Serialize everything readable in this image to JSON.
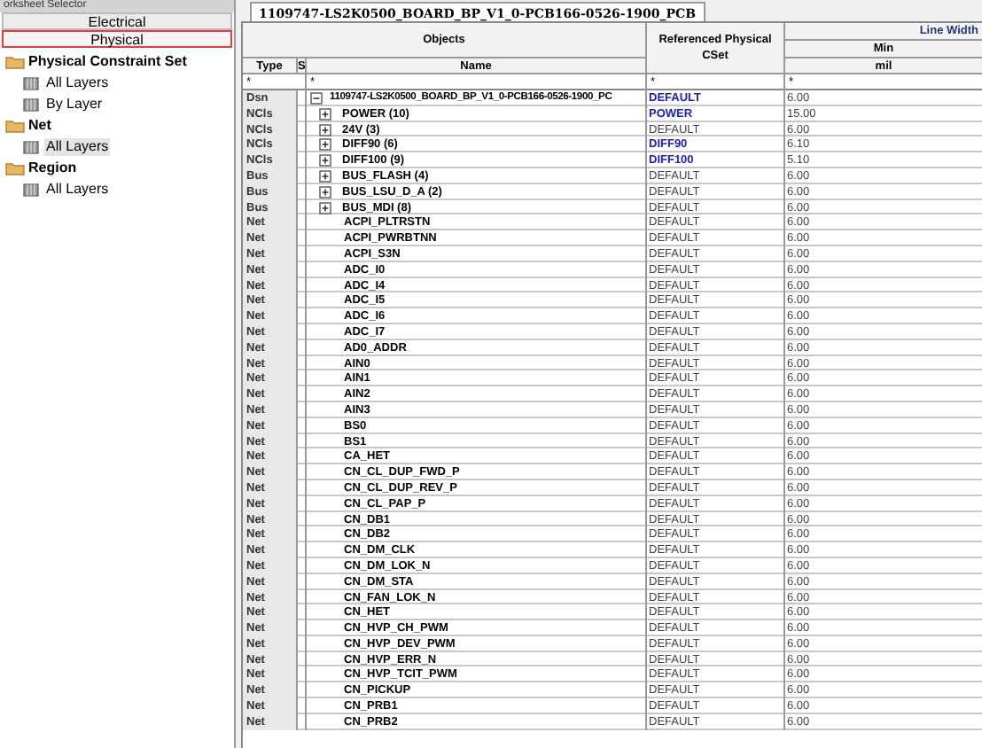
{
  "selector": {
    "title": "orksheet Selector",
    "buttons": [
      {
        "label": "Electrical",
        "selected": false
      },
      {
        "label": "Physical",
        "selected": true
      }
    ],
    "tree": [
      {
        "label": "Physical Constraint Set",
        "children": [
          {
            "label": "All Layers",
            "selected": false
          },
          {
            "label": "By Layer",
            "selected": false
          }
        ]
      },
      {
        "label": "Net",
        "children": [
          {
            "label": "All Layers",
            "selected": true
          }
        ]
      },
      {
        "label": "Region",
        "children": [
          {
            "label": "All Layers",
            "selected": false
          }
        ]
      }
    ]
  },
  "tab": {
    "label": "1109747-LS2K0500_BOARD_BP_V1_0-PCB166-0526-1900_PCB"
  },
  "table": {
    "group_header": "Objects",
    "columns": {
      "type": "Type",
      "s": "S",
      "name": "Name",
      "cset": "Referenced Physical CSet",
      "line_width": "Line Width",
      "min": "Min",
      "unit": "mil"
    },
    "filters": {
      "type": "*",
      "name": "*",
      "cset": "*",
      "min": "*"
    },
    "rows": [
      {
        "type": "Dsn",
        "expandable": true,
        "expanded": true,
        "name": "1109747-LS2K0500_BOARD_BP_V1_0-PCB166-0526-1900_PC",
        "cset": "DEFAULT",
        "linked": true,
        "min": "6.00"
      },
      {
        "type": "NCls",
        "expandable": true,
        "expanded": false,
        "name": "POWER (10)",
        "cset": "POWER",
        "linked": true,
        "min": "15.00"
      },
      {
        "type": "NCls",
        "expandable": true,
        "expanded": false,
        "name": "24V (3)",
        "cset": "DEFAULT",
        "linked": false,
        "min": "6.00"
      },
      {
        "type": "NCls",
        "expandable": true,
        "expanded": false,
        "name": "DIFF90 (6)",
        "cset": "DIFF90",
        "linked": true,
        "min": "6.10"
      },
      {
        "type": "NCls",
        "expandable": true,
        "expanded": false,
        "name": "DIFF100 (9)",
        "cset": "DIFF100",
        "linked": true,
        "min": "5.10"
      },
      {
        "type": "Bus",
        "expandable": true,
        "expanded": false,
        "name": "BUS_FLASH (4)",
        "cset": "DEFAULT",
        "linked": false,
        "min": "6.00"
      },
      {
        "type": "Bus",
        "expandable": true,
        "expanded": false,
        "name": "BUS_LSU_D_A (2)",
        "cset": "DEFAULT",
        "linked": false,
        "min": "6.00"
      },
      {
        "type": "Bus",
        "expandable": true,
        "expanded": false,
        "name": "BUS_MDI (8)",
        "cset": "DEFAULT",
        "linked": false,
        "min": "6.00"
      },
      {
        "type": "Net",
        "expandable": false,
        "expanded": false,
        "name": "ACPI_PLTRSTN",
        "cset": "DEFAULT",
        "linked": false,
        "min": "6.00"
      },
      {
        "type": "Net",
        "expandable": false,
        "expanded": false,
        "name": "ACPI_PWRBTNN",
        "cset": "DEFAULT",
        "linked": false,
        "min": "6.00"
      },
      {
        "type": "Net",
        "expandable": false,
        "expanded": false,
        "name": "ACPI_S3N",
        "cset": "DEFAULT",
        "linked": false,
        "min": "6.00"
      },
      {
        "type": "Net",
        "expandable": false,
        "expanded": false,
        "name": "ADC_I0",
        "cset": "DEFAULT",
        "linked": false,
        "min": "6.00"
      },
      {
        "type": "Net",
        "expandable": false,
        "expanded": false,
        "name": "ADC_I4",
        "cset": "DEFAULT",
        "linked": false,
        "min": "6.00"
      },
      {
        "type": "Net",
        "expandable": false,
        "expanded": false,
        "name": "ADC_I5",
        "cset": "DEFAULT",
        "linked": false,
        "min": "6.00"
      },
      {
        "type": "Net",
        "expandable": false,
        "expanded": false,
        "name": "ADC_I6",
        "cset": "DEFAULT",
        "linked": false,
        "min": "6.00"
      },
      {
        "type": "Net",
        "expandable": false,
        "expanded": false,
        "name": "ADC_I7",
        "cset": "DEFAULT",
        "linked": false,
        "min": "6.00"
      },
      {
        "type": "Net",
        "expandable": false,
        "expanded": false,
        "name": "AD0_ADDR",
        "cset": "DEFAULT",
        "linked": false,
        "min": "6.00"
      },
      {
        "type": "Net",
        "expandable": false,
        "expanded": false,
        "name": "AIN0",
        "cset": "DEFAULT",
        "linked": false,
        "min": "6.00"
      },
      {
        "type": "Net",
        "expandable": false,
        "expanded": false,
        "name": "AIN1",
        "cset": "DEFAULT",
        "linked": false,
        "min": "6.00"
      },
      {
        "type": "Net",
        "expandable": false,
        "expanded": false,
        "name": "AIN2",
        "cset": "DEFAULT",
        "linked": false,
        "min": "6.00"
      },
      {
        "type": "Net",
        "expandable": false,
        "expanded": false,
        "name": "AIN3",
        "cset": "DEFAULT",
        "linked": false,
        "min": "6.00"
      },
      {
        "type": "Net",
        "expandable": false,
        "expanded": false,
        "name": "BS0",
        "cset": "DEFAULT",
        "linked": false,
        "min": "6.00"
      },
      {
        "type": "Net",
        "expandable": false,
        "expanded": false,
        "name": "BS1",
        "cset": "DEFAULT",
        "linked": false,
        "min": "6.00"
      },
      {
        "type": "Net",
        "expandable": false,
        "expanded": false,
        "name": "CA_HET",
        "cset": "DEFAULT",
        "linked": false,
        "min": "6.00"
      },
      {
        "type": "Net",
        "expandable": false,
        "expanded": false,
        "name": "CN_CL_DUP_FWD_P",
        "cset": "DEFAULT",
        "linked": false,
        "min": "6.00"
      },
      {
        "type": "Net",
        "expandable": false,
        "expanded": false,
        "name": "CN_CL_DUP_REV_P",
        "cset": "DEFAULT",
        "linked": false,
        "min": "6.00"
      },
      {
        "type": "Net",
        "expandable": false,
        "expanded": false,
        "name": "CN_CL_PAP_P",
        "cset": "DEFAULT",
        "linked": false,
        "min": "6.00"
      },
      {
        "type": "Net",
        "expandable": false,
        "expanded": false,
        "name": "CN_DB1",
        "cset": "DEFAULT",
        "linked": false,
        "min": "6.00"
      },
      {
        "type": "Net",
        "expandable": false,
        "expanded": false,
        "name": "CN_DB2",
        "cset": "DEFAULT",
        "linked": false,
        "min": "6.00"
      },
      {
        "type": "Net",
        "expandable": false,
        "expanded": false,
        "name": "CN_DM_CLK",
        "cset": "DEFAULT",
        "linked": false,
        "min": "6.00"
      },
      {
        "type": "Net",
        "expandable": false,
        "expanded": false,
        "name": "CN_DM_LOK_N",
        "cset": "DEFAULT",
        "linked": false,
        "min": "6.00"
      },
      {
        "type": "Net",
        "expandable": false,
        "expanded": false,
        "name": "CN_DM_STA",
        "cset": "DEFAULT",
        "linked": false,
        "min": "6.00"
      },
      {
        "type": "Net",
        "expandable": false,
        "expanded": false,
        "name": "CN_FAN_LOK_N",
        "cset": "DEFAULT",
        "linked": false,
        "min": "6.00"
      },
      {
        "type": "Net",
        "expandable": false,
        "expanded": false,
        "name": "CN_HET",
        "cset": "DEFAULT",
        "linked": false,
        "min": "6.00"
      },
      {
        "type": "Net",
        "expandable": false,
        "expanded": false,
        "name": "CN_HVP_CH_PWM",
        "cset": "DEFAULT",
        "linked": false,
        "min": "6.00"
      },
      {
        "type": "Net",
        "expandable": false,
        "expanded": false,
        "name": "CN_HVP_DEV_PWM",
        "cset": "DEFAULT",
        "linked": false,
        "min": "6.00"
      },
      {
        "type": "Net",
        "expandable": false,
        "expanded": false,
        "name": "CN_HVP_ERR_N",
        "cset": "DEFAULT",
        "linked": false,
        "min": "6.00"
      },
      {
        "type": "Net",
        "expandable": false,
        "expanded": false,
        "name": "CN_HVP_TCIT_PWM",
        "cset": "DEFAULT",
        "linked": false,
        "min": "6.00"
      },
      {
        "type": "Net",
        "expandable": false,
        "expanded": false,
        "name": "CN_PICKUP",
        "cset": "DEFAULT",
        "linked": false,
        "min": "6.00"
      },
      {
        "type": "Net",
        "expandable": false,
        "expanded": false,
        "name": "CN_PRB1",
        "cset": "DEFAULT",
        "linked": false,
        "min": "6.00"
      },
      {
        "type": "Net",
        "expandable": false,
        "expanded": false,
        "name": "CN_PRB2",
        "cset": "DEFAULT",
        "linked": false,
        "min": "6.00"
      }
    ]
  }
}
